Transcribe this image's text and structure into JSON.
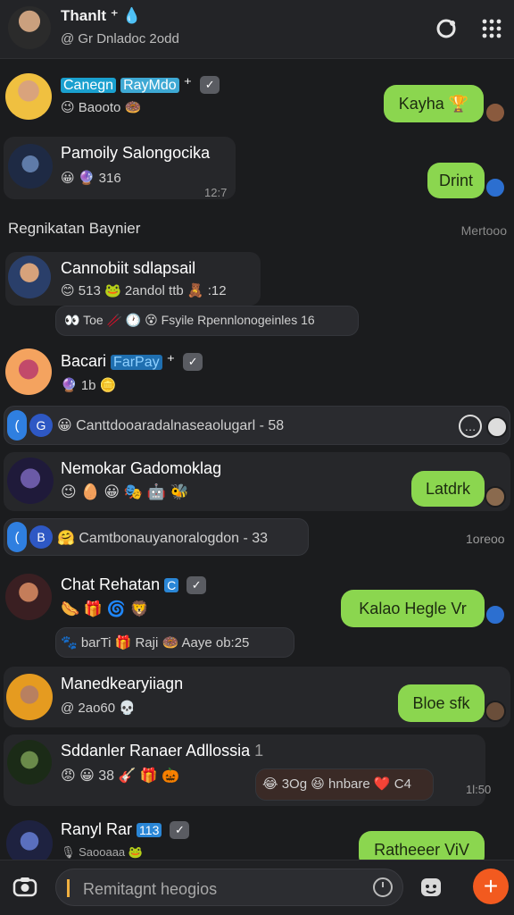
{
  "header": {
    "title": "Thanlt ⁺ 💧",
    "subtitle": "@ Gr Dnladoc 2odd"
  },
  "chats": [
    {
      "name": "Canegn",
      "tag": "RayMdo",
      "tag_suffix": "⁺",
      "meta": "😉 Baooto 🍩",
      "bubble": "Kayha 🏆"
    },
    {
      "name": "Pamoily Salongocika",
      "meta": "😀 🔮 316",
      "time": "12:7",
      "bubble": "Drint"
    },
    {
      "name": "Cannobiit sdlapsail",
      "meta": "😊 513  🐸 2andol   ttb 🧸 :12"
    },
    {
      "name": "Bacari",
      "tag": "FarPay",
      "tag_suffix": "⁺",
      "meta": "🔮 1b 🪙"
    },
    {
      "name": "Nemokar Gadomoklag",
      "meta": "😉 🥚 😀 🎭 🤖 🐝",
      "bubble": "Latdrk"
    },
    {
      "name": "Chat Rehatan",
      "tag": "C",
      "meta": "🌭 🎁 🌀 🦁",
      "bubble": "Kalao Hegle Vr"
    },
    {
      "name": "Manedkearyiiagn",
      "meta": "@ 2ao60 💀",
      "bubble": "Bloe sfk"
    },
    {
      "name": "Sddanler Ranaer Adllossia",
      "badge": "1",
      "meta": "😡 😀 38 🎸 🎁 🎃",
      "time": "1l:50"
    },
    {
      "name": "Ranyl Rar",
      "tag": "113",
      "meta": "🎙 Saooaaa 🐸",
      "bubble": "Ratheeer ViV"
    }
  ],
  "extras": {
    "row3_reply": "👀 Toe 🥢 🕐 😵 Fsyile Rpennlonogeinles  16",
    "pinned_1": "😀 Canttdooaradalnaseaolugarl - 58",
    "pinned_2": "🤗 Camtbonauyanoralogdon - 33",
    "pinned_2_right": "1oreoo",
    "row6_reply": "🐾 barTi 🎁 Raji 🍩 Aaye ob:25",
    "row8_reply": "😂 3Og 😆 hnbare ❤️ C4",
    "section_title": "Regnikatan Baynier",
    "section_right": "Mertooo"
  },
  "composer": {
    "placeholder": "Remitagnt heogios",
    "send_icon": "+"
  },
  "colors": {
    "background": "#1b1c1e",
    "bubble_green": "#8bd64f",
    "tag_blue": "#1aa0cf",
    "send_orange": "#f25a1f"
  }
}
